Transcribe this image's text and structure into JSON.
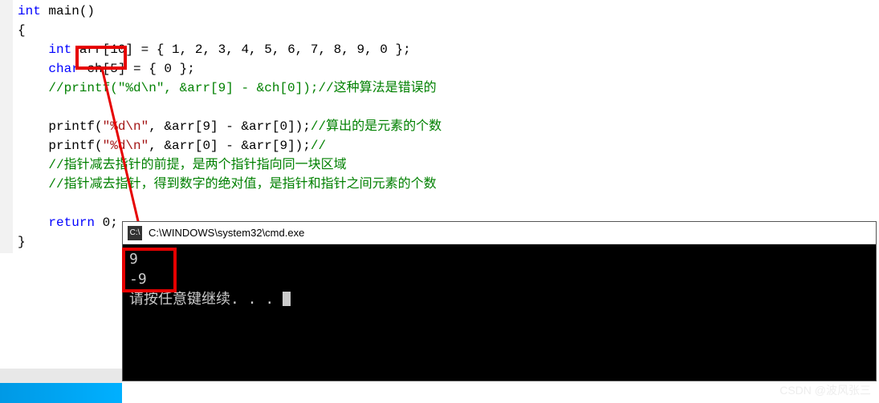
{
  "code": {
    "l1_kw": "int",
    "l1_rest": " main()",
    "l2": "{",
    "l3_indent": "    ",
    "l3_kw": "int",
    "l3_arr": " arr",
    "l3_bracket": "[10]",
    "l3_rest": " = { 1, 2, 3, 4, 5, 6, 7, 8, 9, 0 };",
    "l4_indent": "    ",
    "l4_kw": "char",
    "l4_rest": " ch[5] = { 0 };",
    "l5_indent": "    ",
    "l5_comment": "//printf(\"%d\\n\", &arr[9] - &ch[0]);//这种算法是错误的",
    "l6": "",
    "l7_indent": "    ",
    "l7_a": "printf(",
    "l7_str": "\"%d\\n\"",
    "l7_b": ", &arr[9] - &arr[0]);",
    "l7_c": "//算出的是元素的个数",
    "l8_indent": "    ",
    "l8_a": "printf(",
    "l8_str": "\"%d\\n\"",
    "l8_b": ", &arr[0] - &arr[9]);",
    "l8_c": "//",
    "l9_indent": "    ",
    "l9_comment": "//指针减去指针的前提，是两个指针指向同一块区域",
    "l10_indent": "    ",
    "l10_comment": "//指针减去指针，得到数字的绝对值，是指针和指针之间元素的个数",
    "l11": "",
    "l12_indent": "    ",
    "l12_kw": "return",
    "l12_rest": " 0;",
    "l13": "}"
  },
  "cmd": {
    "title": "C:\\WINDOWS\\system32\\cmd.exe",
    "out1": "9",
    "out2": "-9",
    "prompt": "请按任意键继续. . . "
  },
  "watermark": "CSDN @波风张三"
}
